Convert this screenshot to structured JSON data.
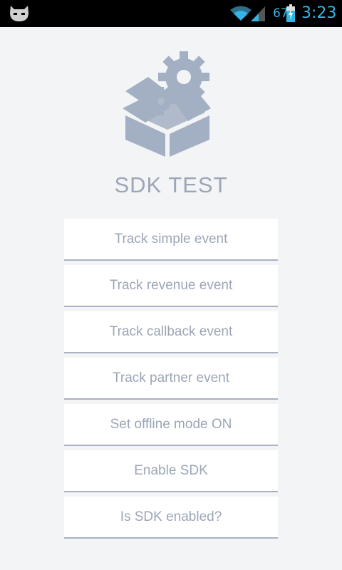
{
  "status_bar": {
    "battery_level": "67",
    "time": "3:23",
    "icons": [
      "cyanogen-icon",
      "wifi-icon",
      "signal-icon",
      "battery-charging-icon"
    ]
  },
  "app": {
    "title": "SDK TEST",
    "logo_icon": "gears-box-icon",
    "accent_color": "#9ca6b6"
  },
  "buttons": [
    {
      "label": "Track simple event"
    },
    {
      "label": "Track revenue event"
    },
    {
      "label": "Track callback event"
    },
    {
      "label": "Track partner event"
    },
    {
      "label": "Set offline mode ON"
    },
    {
      "label": "Enable SDK"
    },
    {
      "label": "Is SDK enabled?"
    }
  ]
}
